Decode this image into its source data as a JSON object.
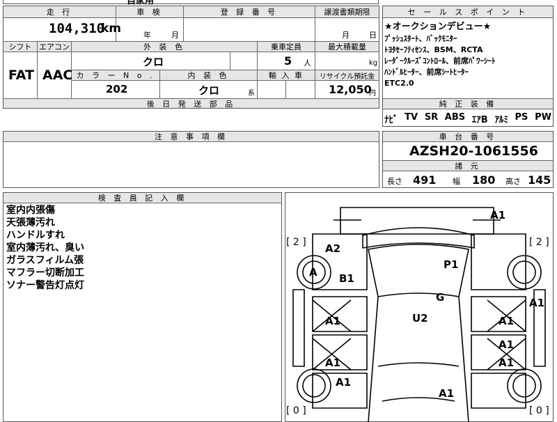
{
  "top_fragment": "自家用",
  "mileage": {
    "label": "走 行",
    "value": "104,310",
    "unit": "km"
  },
  "shaken": {
    "label": "車 検",
    "year_unit": "年",
    "month_unit": "月"
  },
  "registration": {
    "label": "登 録 番 号"
  },
  "transfer": {
    "label": "譲渡書類期限",
    "month_unit": "月",
    "day_unit": "日"
  },
  "shift": {
    "label": "シフト",
    "value": "FAT"
  },
  "aircon": {
    "label": "エアコン",
    "value": "AAC"
  },
  "exterior": {
    "label": "外 装 色",
    "value": "クロ"
  },
  "capacity": {
    "label": "乗車定員",
    "value": "5",
    "unit": "人"
  },
  "max_load": {
    "label": "最大積載量",
    "unit": "kg"
  },
  "color_no": {
    "label": "カ ラ ー N o .",
    "value": "202"
  },
  "interior": {
    "label": "内 装 色",
    "value": "クロ",
    "suffix": "系"
  },
  "import": {
    "label": "輸 入 車"
  },
  "recycle": {
    "label": "リサイクル預託金",
    "value": "12,050",
    "unit": "円"
  },
  "later_parts": {
    "label": "後 日 発 送 部 品"
  },
  "notes": {
    "label": "注 意 事 項 欄"
  },
  "inspector": {
    "label": "検 査 員 記 入 欄",
    "lines": [
      "室内内張傷",
      "天張薄汚れ",
      "ハンドルすれ",
      "室内薄汚れ、臭い",
      "ガラスフィルム張",
      "マフラー切断加工",
      "ソナー警告灯点灯"
    ]
  },
  "sales_points": {
    "label": "セ ー ル ス ポ イ ン ト",
    "lines": [
      "★オークションデビュー★",
      "ﾌﾟｯｼｭｽﾀｰﾄ、ﾊﾞｯｸﾓﾆﾀｰ",
      "ﾄﾖﾀｾｰﾌﾃｨｾﾝｽ、BSM、RCTA",
      "ﾚｰﾀﾞｰｸﾙｰｽﾞｺﾝﾄﾛｰﾙ、前席ﾊﾟﾜｰｼｰﾄ",
      "ﾊﾝﾄﾞﾙﾋｰﾀｰ、前席ｼｰﾄﾋｰﾀｰ",
      "ETC2.0"
    ]
  },
  "factory_equipment": {
    "label": "純 正 装 備",
    "items": [
      "ﾅﾋﾞ",
      "TV",
      "SR",
      "ABS",
      "ｴｱB",
      "ｱﾙﾐ",
      "PS",
      "PW"
    ]
  },
  "chassis": {
    "label": "車 台 番 号",
    "value": "AZSH20-1061556"
  },
  "specs": {
    "label": "諸 元",
    "length_label": "長さ",
    "length": "491",
    "width_label": "幅",
    "width": "180",
    "height_label": "高さ",
    "height": "145"
  },
  "diagram": {
    "marks": [
      "A1",
      "A2",
      "A",
      "B1",
      "P1",
      "G",
      "A1",
      "U2",
      "A1",
      "A1",
      "A1",
      "A1",
      "A1",
      "A1",
      "A1"
    ],
    "corner_tl": "[ 2 ]",
    "corner_tr": "[ 2 ]",
    "corner_bl": "[ 0 ]",
    "corner_br": "[ 0 ]"
  }
}
